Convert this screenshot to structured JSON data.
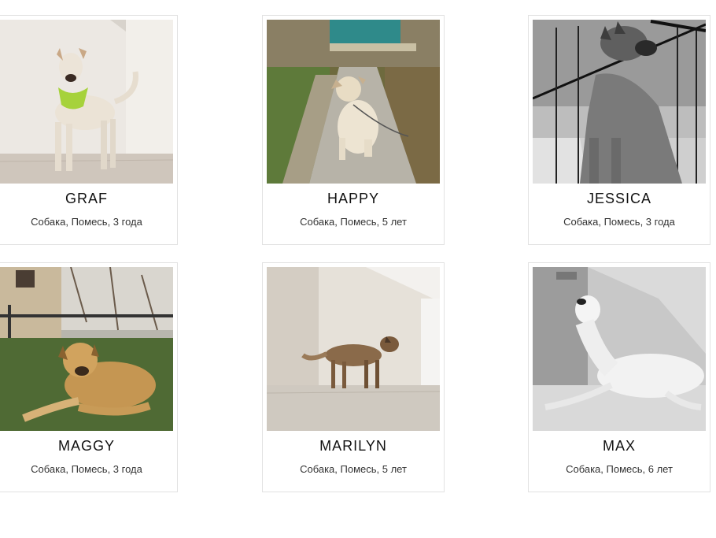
{
  "pets": [
    {
      "name": "GRAF",
      "meta": "Собака, Помесь, 3 года"
    },
    {
      "name": "HAPPY",
      "meta": "Собака, Помесь, 5 лет"
    },
    {
      "name": "JESSICA",
      "meta": "Собака, Помесь, 3 года"
    },
    {
      "name": "MAGGY",
      "meta": "Собака, Помесь, 3 года"
    },
    {
      "name": "MARILYN",
      "meta": "Собака, Помесь, 5 лет"
    },
    {
      "name": "MAX",
      "meta": "Собака, Помесь, 6 лет"
    }
  ]
}
